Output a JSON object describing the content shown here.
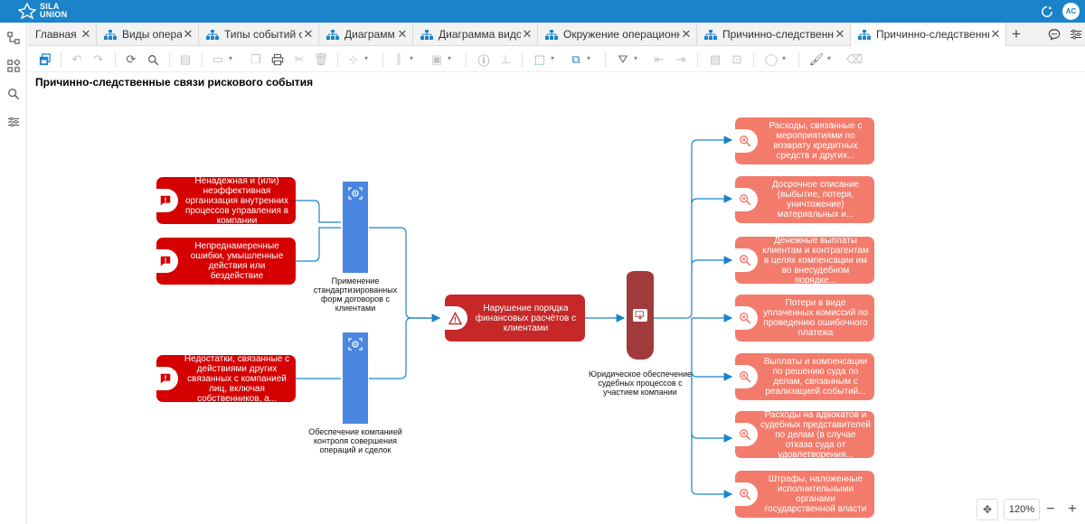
{
  "app": {
    "logo_line1": "SILA",
    "logo_line2": "UNION",
    "user_initials": "AC"
  },
  "tabs": [
    {
      "label": "Главная с",
      "has_icon": false,
      "active": false
    },
    {
      "label": "Виды опера",
      "has_icon": true,
      "active": false
    },
    {
      "label": "Типы событий о",
      "has_icon": true,
      "active": false
    },
    {
      "label": "Диаграмм",
      "has_icon": true,
      "active": false
    },
    {
      "label": "Диаграмма видо",
      "has_icon": true,
      "active": false
    },
    {
      "label": "Окружение операционн",
      "has_icon": true,
      "active": false
    },
    {
      "label": "Причинно-следственны",
      "has_icon": true,
      "active": false
    },
    {
      "label": "Причинно-следственны",
      "has_icon": true,
      "active": true
    }
  ],
  "tab_add": "+",
  "page_title": "Причинно-следственные связи рискового события",
  "causes": [
    "Ненадежная и (или) неэффективная организация внутренних процессов управления в компании",
    "Непреднамеренные ошибки, умышленные действия или бездействие",
    "Недостатки, связанные с действиями других связанных с компанией лиц, включая собственников, а..."
  ],
  "controls": [
    "Применение стандартизированных форм договоров с клиентами",
    "Обеспечение компанией контроля совершения операций и сделок"
  ],
  "event": "Нарушение порядка финансовых расчётов с клиентами",
  "barrier": "Юридическое обеспечение судебных процессов с участием компании",
  "consequences": [
    "Расходы, связанные с мероприятиями по возврату кредитных средств и других...",
    "Досрочное списание (выбытие, потеря, уничтожение) материальных и...",
    "Денежные выплаты клиентам и контрагентам в целях компенсации им во внесудебном порядке...",
    "Потери в виде уплаченных комиссий по проведению ошибочного платежа",
    "Выплаты и компенсации по решению суда по делам, связанным с реализацией событий...",
    "Расходы на адвокатов и судебных представителей по делам (в случае отказа суда от удовлетворения...",
    "Штрафы, наложенные исполнительными органами государственной власти"
  ],
  "zoom": {
    "level": "120%",
    "minus": "−",
    "plus": "+"
  },
  "colors": {
    "header": "#1a83c9",
    "cause": "#d50000",
    "control": "#4a86e0",
    "event": "#c62828",
    "barrier": "#a13a3a",
    "consequence": "#f37b6b",
    "connector": "#1a83c9"
  }
}
